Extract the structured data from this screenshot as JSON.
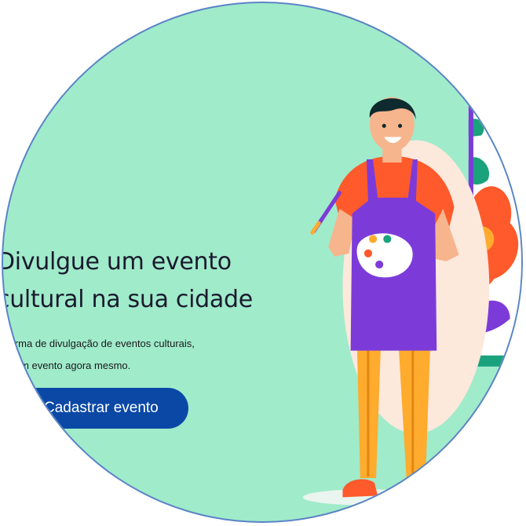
{
  "hero": {
    "headline_line1": "Divulgue um evento",
    "headline_line2": "cultural na sua cidade",
    "desc_line1": "forma de divulgação de eventos culturais,",
    "desc_line2": "e um evento agora mesmo.",
    "cta_label": "Cadastrar evento"
  },
  "colors": {
    "background": "#a0ebca",
    "cta": "#0b48a6",
    "apron": "#7c3bd9",
    "shirt": "#ff5a2b",
    "pants": "#ffab2e"
  },
  "icons": [
    "artist-illustration",
    "paint-palette-icon",
    "paintbrush-icon",
    "painting-canvas"
  ]
}
